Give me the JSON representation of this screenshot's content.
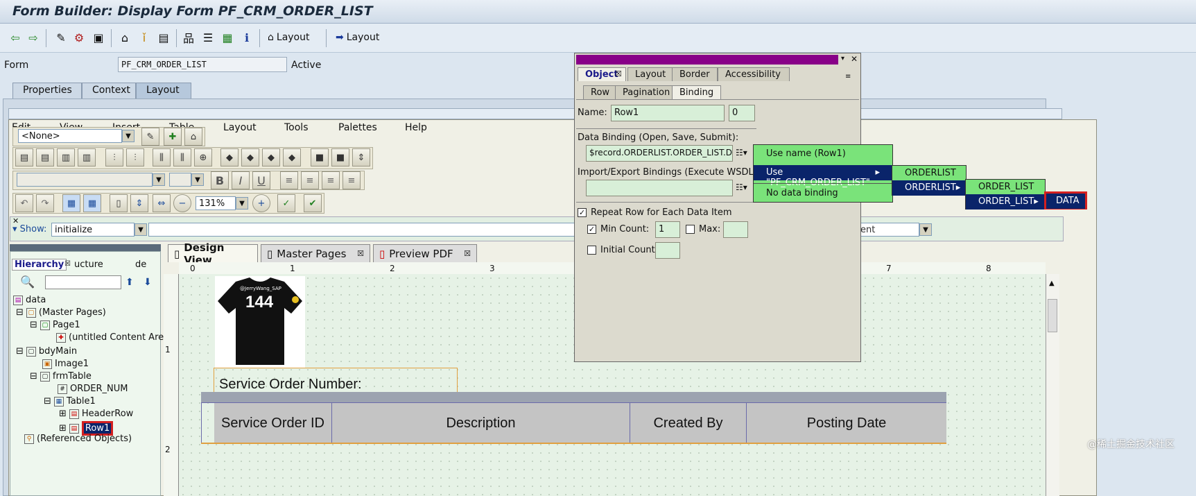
{
  "window": {
    "title": "Form Builder: Display Form PF_CRM_ORDER_LIST"
  },
  "toolbar": {
    "layout_btn1": "Layout",
    "layout_btn2": "Layout"
  },
  "form": {
    "label": "Form",
    "value": "PF_CRM_ORDER_LIST",
    "status": "Active"
  },
  "main_tabs": [
    "Properties",
    "Context",
    "Layout"
  ],
  "menubar": [
    "Edit",
    "View",
    "Insert",
    "Table",
    "Layout",
    "Tools",
    "Palettes",
    "Help"
  ],
  "style_dropdown": "<None>",
  "zoom": "131%",
  "show": {
    "label": "Show:",
    "value": "initialize",
    "right_fragment": "ent"
  },
  "hierarchy": {
    "tabs": [
      "Hierarchy",
      "ucture",
      "de"
    ],
    "items": [
      "data",
      "(Master Pages)",
      "Page1",
      "(untitled Content Are",
      "bdyMain",
      "Image1",
      "frmTable",
      "ORDER_NUM",
      "Table1",
      "HeaderRow",
      "Row1",
      "(Referenced Objects)"
    ]
  },
  "design_tabs": [
    "Design View",
    "Master Pages",
    "Preview PDF"
  ],
  "ruler": {
    "h": [
      "0",
      "1",
      "2",
      "3",
      "7",
      "8"
    ],
    "v": [
      "1",
      "2"
    ]
  },
  "canvas": {
    "shirt_text1": "@JerryWang_SAP",
    "shirt_number": "144",
    "service_order_label": "Service Order Number:",
    "table_headers": [
      "Service Order ID",
      "Description",
      "Created By",
      "Posting Date"
    ]
  },
  "popup": {
    "tabs": [
      "Object",
      "Layout",
      "Border",
      "Accessibility"
    ],
    "subtabs": [
      "Row",
      "Pagination",
      "Binding"
    ],
    "name_label": "Name:",
    "name_value": "Row1",
    "name_index": "0",
    "data_binding_label": "Data Binding (Open, Save, Submit):",
    "data_binding_value": "$record.ORDERLIST.ORDER_LIST.DA",
    "import_export_label": "Import/Export Bindings (Execute WSDL):",
    "repeat_row_label": "Repeat Row for Each Data Item",
    "min_count_label": "Min Count:",
    "min_count_value": "1",
    "max_label": "Max:",
    "initial_count_label": "Initial Count:"
  },
  "menus": {
    "m1": [
      "Use name (Row1)",
      "Use \"PF_CRM_ORDER_LIST\"",
      "No data binding"
    ],
    "m2": [
      "ORDERLIST",
      "ORDERLIST"
    ],
    "m3": [
      "ORDER_LIST",
      "ORDER_LIST"
    ],
    "m4": [
      "DATA"
    ]
  },
  "watermark": "@稀土掘金技术社区",
  "colors": {
    "popup_header": "#880088",
    "menu_bg": "#7ae37a",
    "menu_sel": "#0a246a",
    "highlight": "#d42020"
  }
}
